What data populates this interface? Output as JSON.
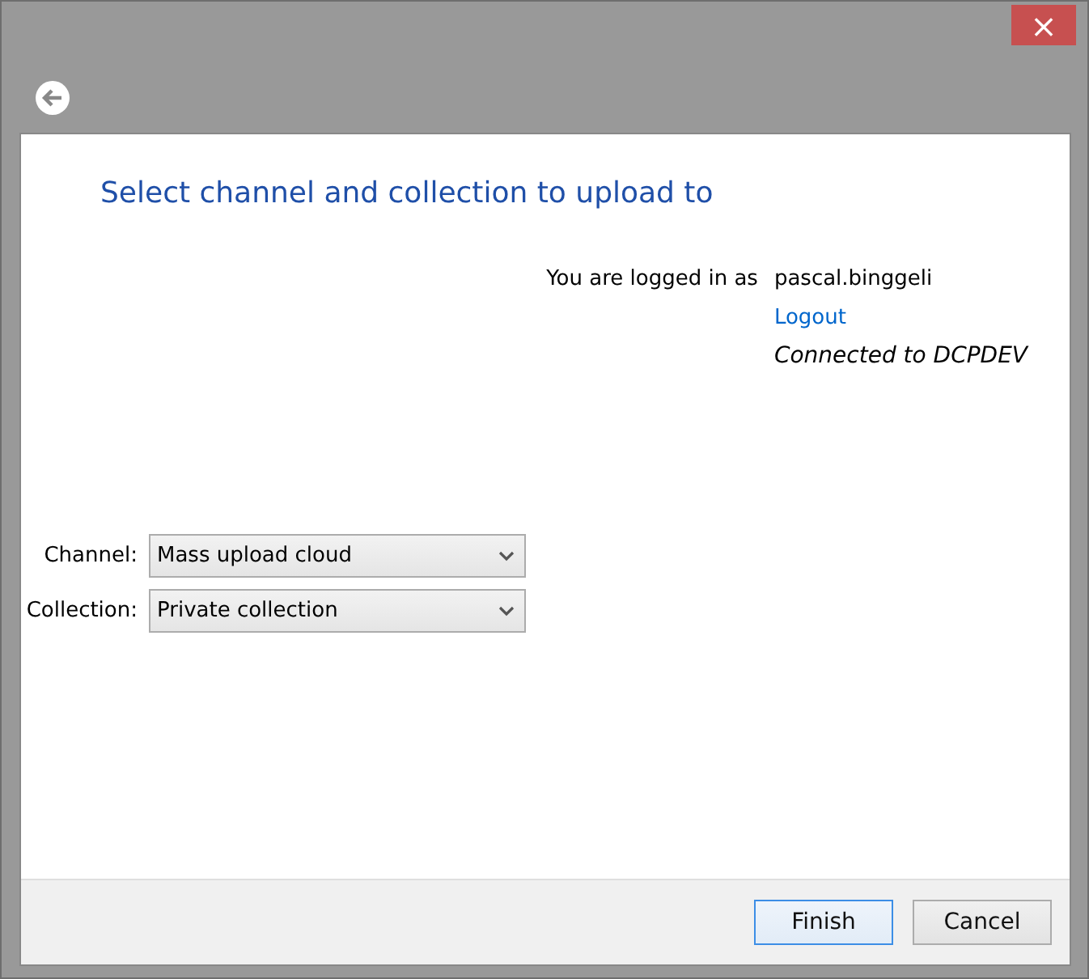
{
  "window": {
    "close_button": "×"
  },
  "page": {
    "title": "Select channel and collection to upload to"
  },
  "login": {
    "label": "You are logged in as",
    "user": "pascal.binggeli",
    "logout_link": "Logout",
    "connection": "Connected to DCPDEV"
  },
  "fields": [
    {
      "label": "Channel:",
      "value": "Mass upload cloud"
    },
    {
      "label": "Collection:",
      "value": "Private collection"
    }
  ],
  "buttons": [
    {
      "label": "Finish",
      "default": true
    },
    {
      "label": "Cancel",
      "default": false
    }
  ]
}
